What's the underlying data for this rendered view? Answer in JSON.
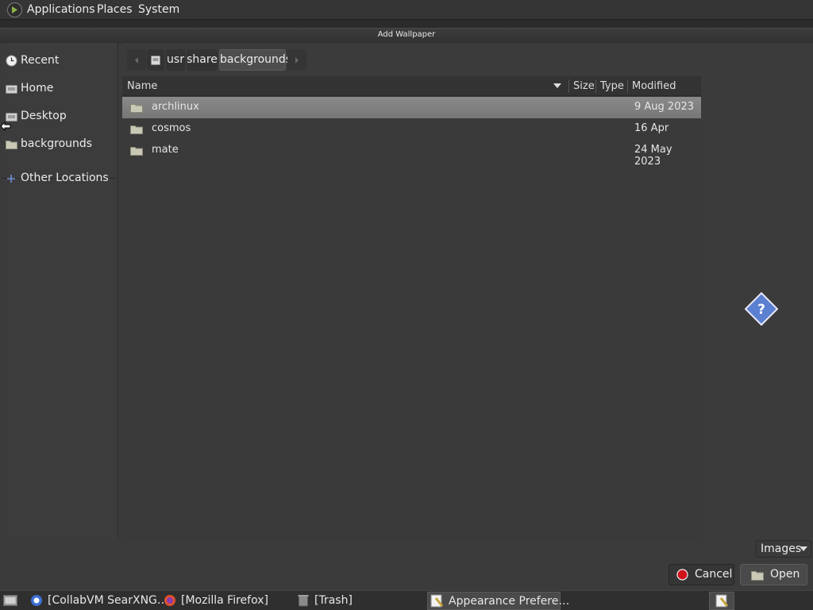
{
  "top_panel": {
    "menus": [
      "Applications",
      "Places",
      "System"
    ]
  },
  "dialog": {
    "title": "Add Wallpaper",
    "sidebar": {
      "items": [
        {
          "label": "Recent",
          "icon": "clock-icon"
        },
        {
          "label": "Home",
          "icon": "home-drive-icon"
        },
        {
          "label": "Desktop",
          "icon": "desktop-drive-icon"
        },
        {
          "label": "backgrounds",
          "icon": "folder-icon"
        },
        {
          "label": "Other Locations",
          "icon": "plus-icon"
        }
      ]
    },
    "path": {
      "segments": [
        "usr",
        "share",
        "backgrounds"
      ],
      "active": "backgrounds"
    },
    "columns": {
      "name": "Name",
      "size": "Size",
      "type": "Type",
      "modified": "Modified"
    },
    "files": [
      {
        "name": "archlinux",
        "size": "",
        "type": "",
        "modified": "9 Aug 2023",
        "selected": true
      },
      {
        "name": "cosmos",
        "size": "",
        "type": "",
        "modified": "16 Apr",
        "selected": false
      },
      {
        "name": "mate",
        "size": "",
        "type": "",
        "modified": "24 May 2023",
        "selected": false
      }
    ],
    "preview": {
      "icon": "question-diamond-icon",
      "text": "?"
    },
    "filter": {
      "value": "Images"
    },
    "buttons": {
      "cancel": "Cancel",
      "open": "Open"
    }
  },
  "taskbar": {
    "tasks": [
      {
        "label": "[CollabVM SearXNG…",
        "icon": "browser-icon",
        "active": false
      },
      {
        "label": "[Mozilla Firefox]",
        "icon": "firefox-icon",
        "active": false
      },
      {
        "label": "[Trash]",
        "icon": "trash-icon",
        "active": false
      },
      {
        "label": "Appearance Prefere…",
        "icon": "appearance-icon",
        "active": true
      }
    ]
  },
  "colors": {
    "selection": "#808080",
    "cancel_icon": "#d0121b",
    "preview_icon": "#5b7fd1"
  }
}
